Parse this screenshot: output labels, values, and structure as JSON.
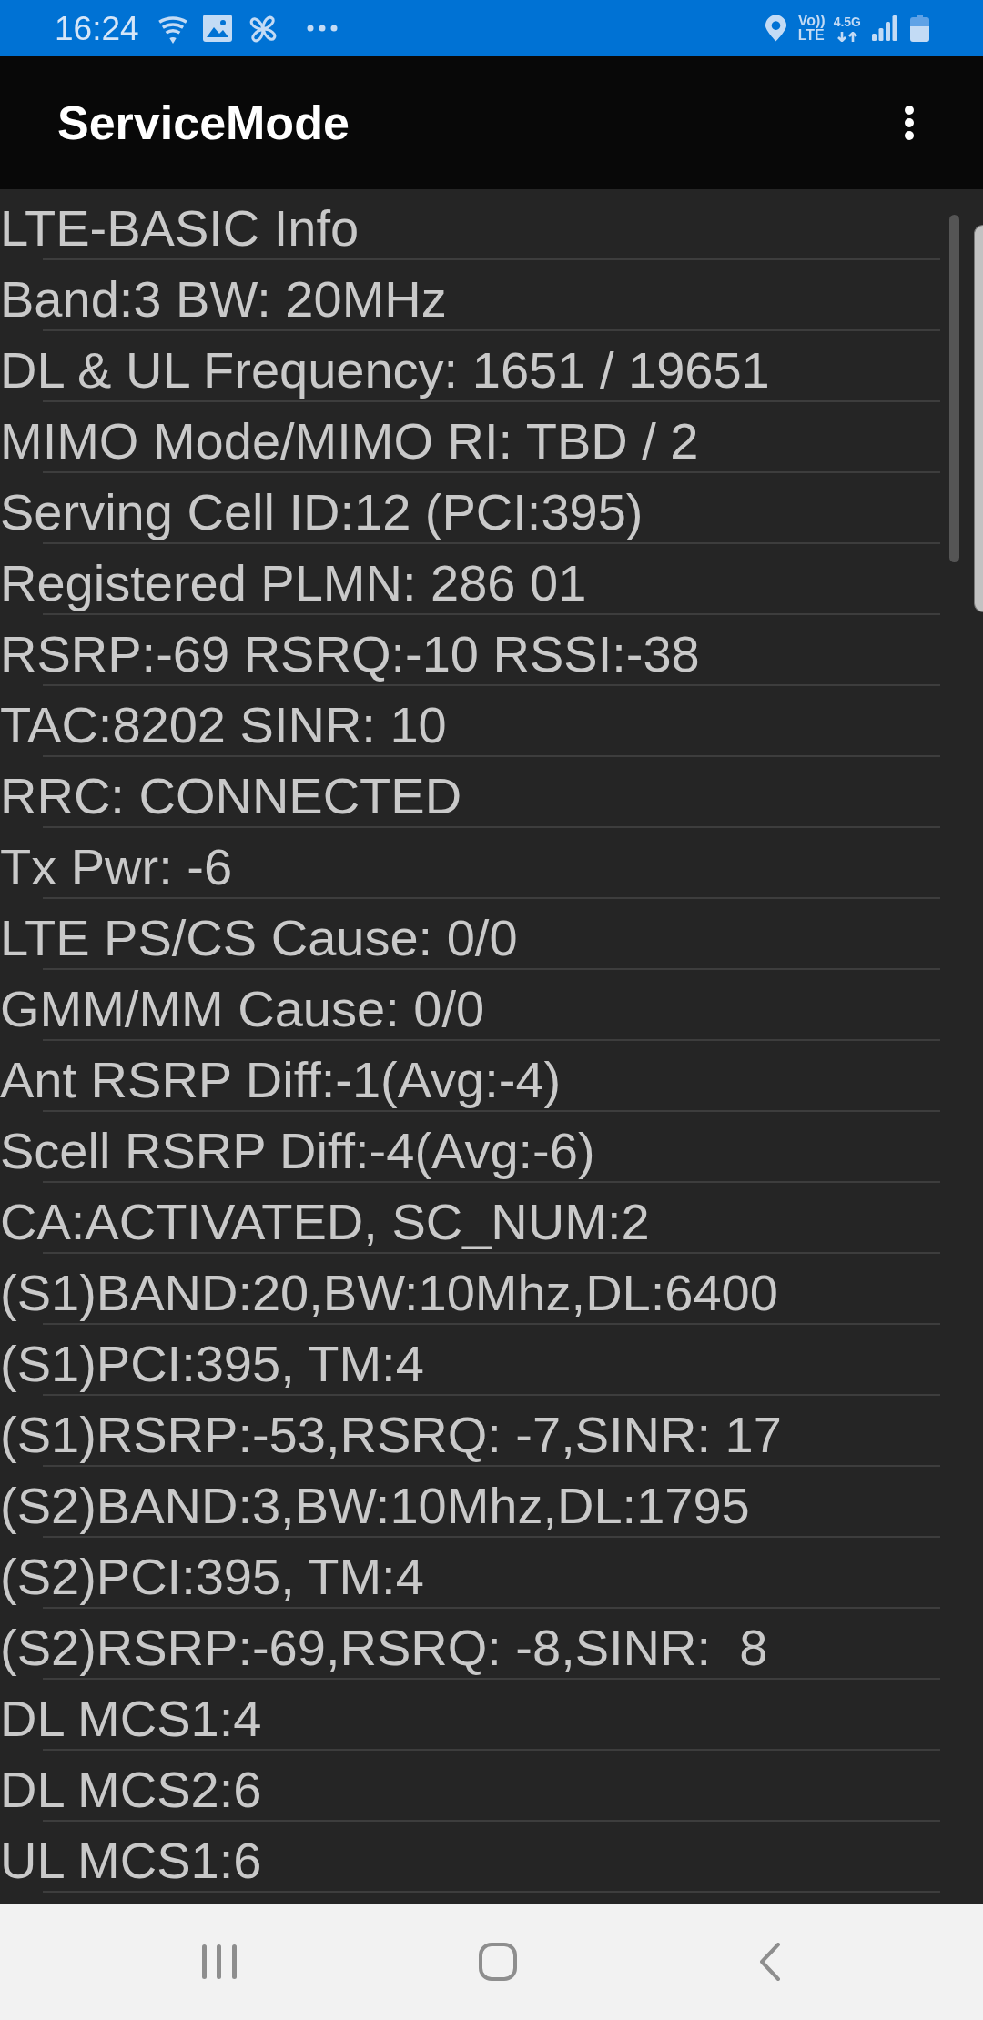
{
  "status_bar": {
    "time": "16:24",
    "volte": [
      "Vo))",
      "LTE"
    ],
    "network_type": "4.5G"
  },
  "app_bar": {
    "title": "ServiceMode"
  },
  "info_lines": [
    "LTE-BASIC Info",
    "Band:3 BW: 20MHz",
    "DL & UL Frequency: 1651 / 19651",
    "MIMO Mode/MIMO RI: TBD / 2",
    "Serving Cell ID:12 (PCI:395)",
    "Registered PLMN: 286 01",
    "RSRP:-69 RSRQ:-10 RSSI:-38",
    "TAC:8202 SINR: 10",
    "RRC: CONNECTED",
    "Tx Pwr: -6",
    "LTE PS/CS Cause: 0/0",
    "GMM/MM Cause: 0/0",
    "Ant RSRP Diff:-1(Avg:-4)",
    "Scell RSRP Diff:-4(Avg:-6)",
    "CA:ACTIVATED, SC_NUM:2",
    "(S1)BAND:20,BW:10Mhz,DL:6400",
    "(S1)PCI:395, TM:4",
    "(S1)RSRP:-53,RSRQ: -7,SINR: 17",
    "(S2)BAND:3,BW:10Mhz,DL:1795",
    "(S2)PCI:395, TM:4",
    "(S2)RSRP:-69,RSRQ: -8,SINR:  8",
    "DL MCS1:4",
    "DL MCS2:6",
    "UL MCS1:6"
  ]
}
